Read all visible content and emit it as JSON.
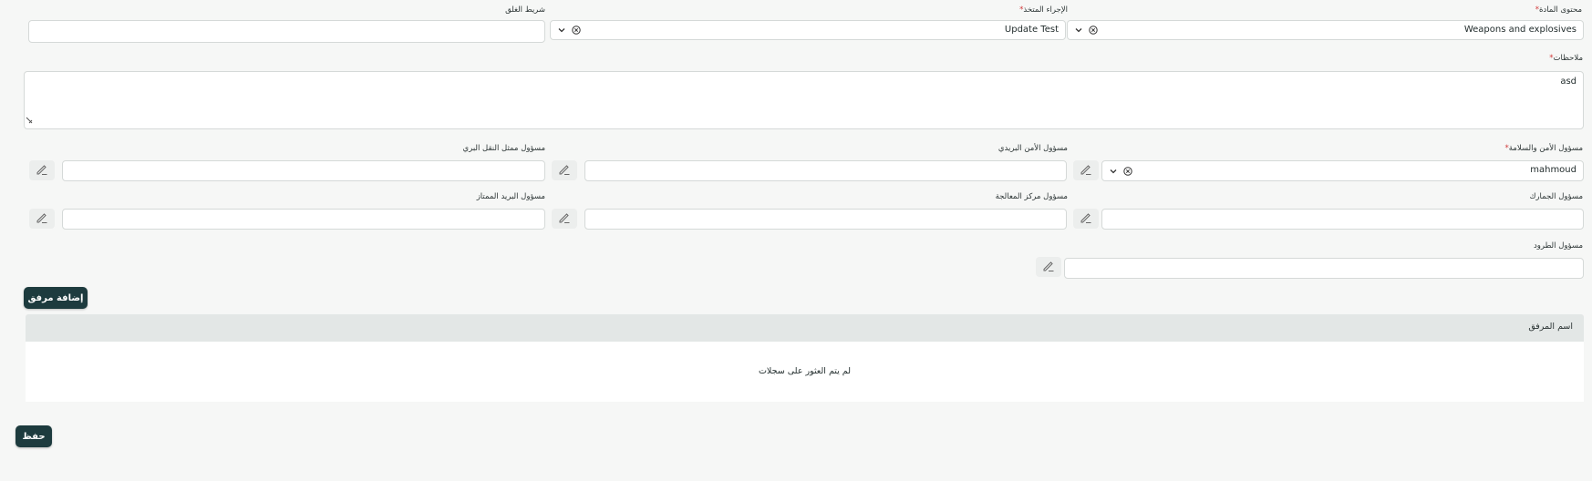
{
  "form": {
    "material_content": {
      "label": "محتوى المادة",
      "value": "Weapons and explosives"
    },
    "action_taken": {
      "label": "الإجراء المتخذ",
      "value": "Update Test"
    },
    "lock_tape": {
      "label": "شريط الغلق",
      "value": ""
    },
    "notes": {
      "label": "ملاحظات",
      "value": "asd"
    },
    "safety_officer": {
      "label": "مسؤول الأمن والسلامة",
      "value": "mahmoud"
    },
    "postal_security_officer": {
      "label": "مسؤول الأمن البريدي",
      "value": ""
    },
    "land_transport_officer": {
      "label": "مسؤول ممثل النقل البري",
      "value": ""
    },
    "customs_officer": {
      "label": "مسؤول الجمارك",
      "value": ""
    },
    "processing_center_officer": {
      "label": "مسؤول مركز المعالجة",
      "value": ""
    },
    "express_mail_officer": {
      "label": "مسؤول البريد الممتاز",
      "value": ""
    },
    "parcels_officer": {
      "label": "مسؤول الطرود",
      "value": ""
    }
  },
  "attachments": {
    "add_button": "إضافة مرفق",
    "column_header": "اسم المرفق",
    "empty_text": "لم يتم العثور على سجلات"
  },
  "save_button": "حفظ",
  "required_mark": "*",
  "colors": {
    "background": "#f6f7f6",
    "primary_button": "#1d3b3e",
    "required": "#d23b3b",
    "border": "#d5d9d8"
  }
}
